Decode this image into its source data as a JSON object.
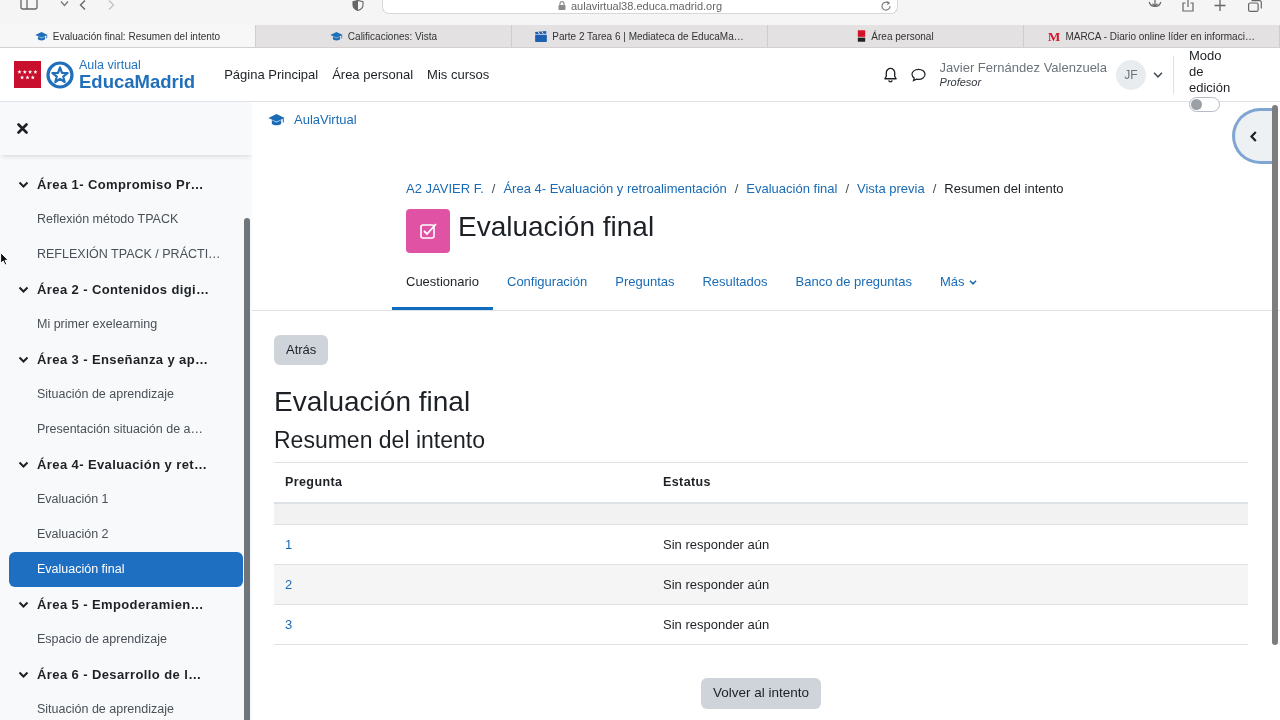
{
  "browser": {
    "address": "aulavirtual38.educa.madrid.org",
    "tabs": [
      {
        "title": "Evaluación final: Resumen del intento",
        "kind": "cap",
        "selected": true
      },
      {
        "title": "Calificaciones: Vista",
        "kind": "cap",
        "selected": false
      },
      {
        "title": "Parte 2 Tarea 6 | Mediateca de EducaMa…",
        "kind": "film",
        "selected": false
      },
      {
        "title": "Área personal",
        "kind": "badge",
        "selected": false
      },
      {
        "title": "MARCA - Diario online líder en informaci…",
        "kind": "letter",
        "favicon_text": "M",
        "selected": false
      }
    ]
  },
  "navbar": {
    "logo": {
      "subtitle": "Aula virtual",
      "title": "EducaMadrid"
    },
    "links": [
      "Página Principal",
      "Área personal",
      "Mis cursos"
    ],
    "user": {
      "name": "Javier Fernández Valenzuela",
      "role": "Profesor",
      "initials": "JF"
    },
    "edit_mode": {
      "label": "Modo de edición",
      "on": false
    }
  },
  "sidebar": {
    "items": [
      {
        "label": "Área 1- Compromiso Pr…",
        "expanded": true,
        "children": [
          {
            "label": "Reflexión método TPACK",
            "selected": false
          },
          {
            "label": "REFLEXIÓN TPACK / PRÁCTI…",
            "selected": false
          }
        ]
      },
      {
        "label": "Área 2 - Contenidos digi…",
        "expanded": true,
        "children": [
          {
            "label": "Mi primer exelearning",
            "selected": false
          }
        ]
      },
      {
        "label": "Área 3 - Enseñanza y ap…",
        "expanded": true,
        "children": [
          {
            "label": "Situación de aprendizaje",
            "selected": false
          },
          {
            "label": "Presentación situación de a…",
            "selected": false
          }
        ]
      },
      {
        "label": "Área 4- Evaluación y ret…",
        "expanded": true,
        "children": [
          {
            "label": "Evaluación 1",
            "selected": false
          },
          {
            "label": "Evaluación 2",
            "selected": false
          },
          {
            "label": "Evaluación final",
            "selected": true
          }
        ]
      },
      {
        "label": "Área 5 - Empoderamien…",
        "expanded": true,
        "children": [
          {
            "label": "Espacio de aprendizaje",
            "selected": false
          }
        ]
      },
      {
        "label": "Área 6 - Desarrollo de l…",
        "expanded": true,
        "children": [
          {
            "label": "Situación de aprendizaje",
            "selected": false
          }
        ]
      }
    ]
  },
  "main": {
    "home_link": "AulaVirtual",
    "breadcrumb": {
      "separator": "/",
      "items": [
        {
          "label": "A2 JAVIER F.",
          "current": false
        },
        {
          "label": "Área 4- Evaluación y retroalimentación",
          "current": false
        },
        {
          "label": "Evaluación final",
          "current": false
        },
        {
          "label": "Vista previa",
          "current": false
        },
        {
          "label": "Resumen del intento",
          "current": true
        }
      ]
    },
    "title": "Evaluación final",
    "tabs": [
      {
        "label": "Cuestionario",
        "kind": "link",
        "selected": true
      },
      {
        "label": "Configuración",
        "kind": "link",
        "selected": false
      },
      {
        "label": "Preguntas",
        "kind": "link",
        "selected": false
      },
      {
        "label": "Resultados",
        "kind": "link",
        "selected": false
      },
      {
        "label": "Banco de preguntas",
        "kind": "link",
        "selected": false
      },
      {
        "label": "Más",
        "kind": "menu",
        "selected": false
      }
    ],
    "back_button": "Atrás",
    "heading": "Evaluación final",
    "subheading": "Resumen del intento",
    "table": {
      "columns": [
        "Pregunta",
        "Estatus"
      ],
      "rows": [
        {
          "question": "1",
          "status": "Sin responder aún"
        },
        {
          "question": "2",
          "status": "Sin responder aún"
        },
        {
          "question": "3",
          "status": "Sin responder aún"
        }
      ]
    },
    "return_button": "Volver al intento"
  }
}
